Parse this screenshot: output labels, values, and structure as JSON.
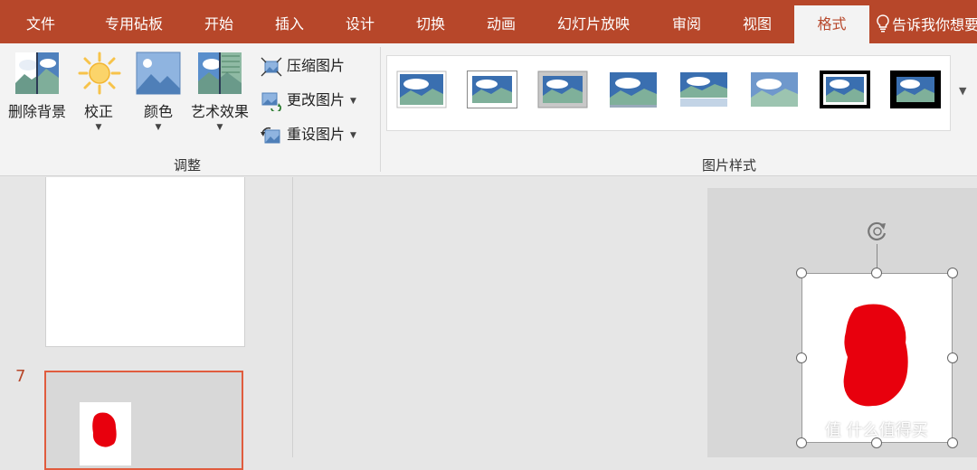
{
  "tabs": [
    "文件",
    "专用砧板",
    "开始",
    "插入",
    "设计",
    "切换",
    "动画",
    "幻灯片放映",
    "审阅",
    "视图",
    "格式"
  ],
  "active_tab": "格式",
  "tell_me": "告诉我你想要",
  "adjust_group": {
    "remove_background": "删除背景",
    "corrections": "校正",
    "color": "颜色",
    "artistic_effects": "艺术效果",
    "compress": "压缩图片",
    "change_picture": "更改图片",
    "reset_picture": "重设图片",
    "label": "调整"
  },
  "styles_group": {
    "label": "图片样式"
  },
  "slides": {
    "active_number": "7"
  },
  "watermark": "值 什么值得买",
  "colors": {
    "accent": "#b7472a",
    "selection": "#e05c3e",
    "shape": "#e8000d"
  }
}
